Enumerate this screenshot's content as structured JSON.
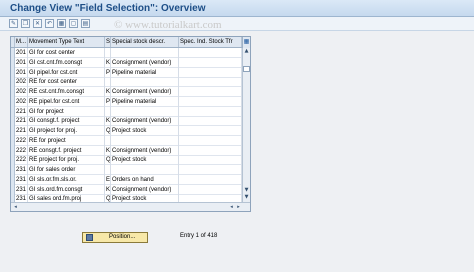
{
  "title": "Change View \"Field Selection\": Overview",
  "watermark": "© www.tutorialkart.com",
  "toolbar": {
    "icons": [
      "new-entries-icon",
      "copy-icon",
      "delete-icon",
      "undo-icon",
      "select-all-icon",
      "deselect-all-icon",
      "select-block-icon"
    ]
  },
  "table": {
    "headers": {
      "m": "M...",
      "movement_type_text": "Movement Type Text",
      "s": "S",
      "special_stock_descr": "Special stock descr.",
      "spec_ind_stock": "Spec. Ind. Stock Tfr"
    },
    "rows": [
      {
        "mvt": "201",
        "text": "GI for cost center",
        "s": "",
        "descr": ""
      },
      {
        "mvt": "201",
        "text": "GI cst.cnt.fm.consgt",
        "s": "K",
        "descr": "Consignment (vendor)"
      },
      {
        "mvt": "201",
        "text": "GI pipel.for cst.cnt",
        "s": "P",
        "descr": "Pipeline material"
      },
      {
        "mvt": "202",
        "text": "RE for cost center",
        "s": "",
        "descr": ""
      },
      {
        "mvt": "202",
        "text": "RE cst.cnt.fm.consgt",
        "s": "K",
        "descr": "Consignment (vendor)"
      },
      {
        "mvt": "202",
        "text": "RE pipel.for cst.cnt",
        "s": "P",
        "descr": "Pipeline material"
      },
      {
        "mvt": "221",
        "text": "GI for project",
        "s": "",
        "descr": ""
      },
      {
        "mvt": "221",
        "text": "GI consgt.f. project",
        "s": "K",
        "descr": "Consignment (vendor)"
      },
      {
        "mvt": "221",
        "text": "GI project for proj.",
        "s": "Q",
        "descr": "Project stock"
      },
      {
        "mvt": "222",
        "text": "RE for project",
        "s": "",
        "descr": ""
      },
      {
        "mvt": "222",
        "text": "RE consgt.f. project",
        "s": "K",
        "descr": "Consignment (vendor)"
      },
      {
        "mvt": "222",
        "text": "RE project for proj.",
        "s": "Q",
        "descr": "Project stock"
      },
      {
        "mvt": "231",
        "text": "GI for sales order",
        "s": "",
        "descr": ""
      },
      {
        "mvt": "231",
        "text": "GI sls.or.fm.sls.or.",
        "s": "E",
        "descr": "Orders on hand"
      },
      {
        "mvt": "231",
        "text": "GI sls.ord.fm.consgt",
        "s": "K",
        "descr": "Consignment (vendor)"
      },
      {
        "mvt": "231",
        "text": "GI sales ord.fm.proj",
        "s": "Q",
        "descr": "Project stock"
      }
    ]
  },
  "position_button": {
    "label": "Position...",
    "icon": "position-icon"
  },
  "entry_status": "Entry 1 of 418"
}
